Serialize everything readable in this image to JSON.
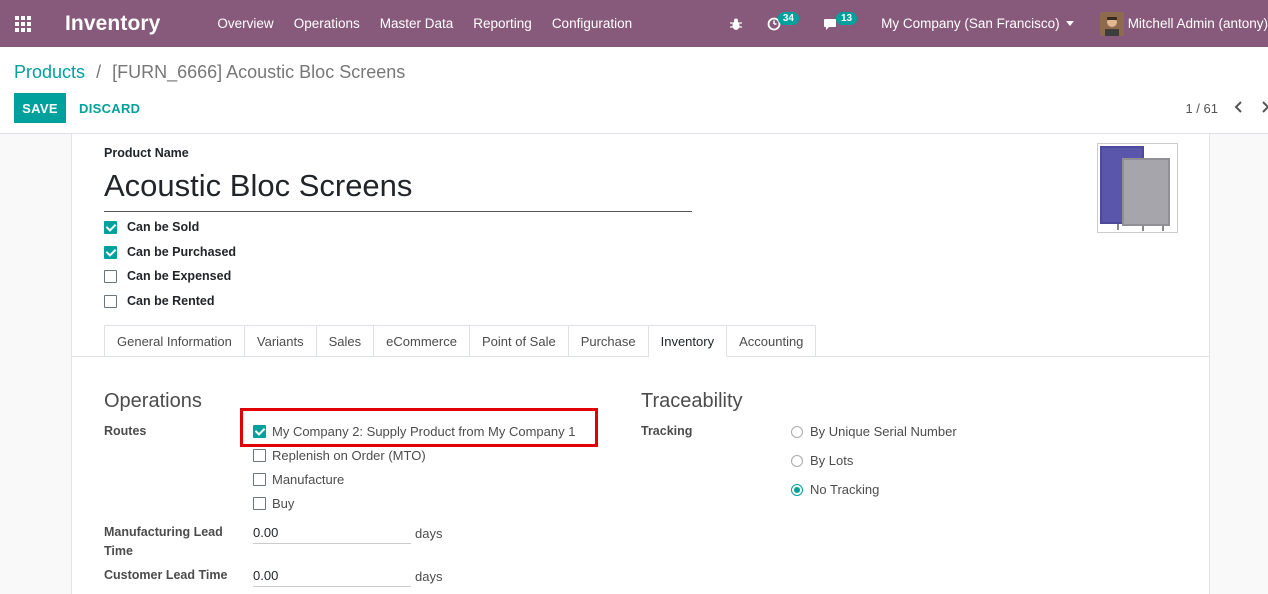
{
  "navbar": {
    "app_title": "Inventory",
    "menu": [
      "Overview",
      "Operations",
      "Master Data",
      "Reporting",
      "Configuration"
    ],
    "activity_count": "34",
    "message_count": "13",
    "company": "My Company (San Francisco)",
    "user": "Mitchell Admin (antony)"
  },
  "control": {
    "breadcrumb_root": "Products",
    "breadcrumb_sep": "/",
    "breadcrumb_current": "[FURN_6666] Acoustic Bloc Screens",
    "save_label": "SAVE",
    "discard_label": "DISCARD",
    "pager": "1 / 61"
  },
  "form": {
    "product_name_label": "Product Name",
    "product_name": "Acoustic Bloc Screens",
    "flags": [
      {
        "label": "Can be Sold",
        "checked": true
      },
      {
        "label": "Can be Purchased",
        "checked": true
      },
      {
        "label": "Can be Expensed",
        "checked": false
      },
      {
        "label": "Can be Rented",
        "checked": false
      }
    ],
    "tabs": [
      "General Information",
      "Variants",
      "Sales",
      "eCommerce",
      "Point of Sale",
      "Purchase",
      "Inventory",
      "Accounting"
    ],
    "active_tab": "Inventory"
  },
  "operations": {
    "title": "Operations",
    "routes_label": "Routes",
    "routes": [
      {
        "label": "My Company 2: Supply Product from My Company 1",
        "checked": true
      },
      {
        "label": "Replenish on Order (MTO)",
        "checked": false
      },
      {
        "label": "Manufacture",
        "checked": false
      },
      {
        "label": "Buy",
        "checked": false
      }
    ],
    "mfg_lead_label_1": "Manufacturing Lead",
    "mfg_lead_label_2": "Time",
    "mfg_lead_value": "0.00",
    "customer_lead_label": "Customer Lead Time",
    "customer_lead_value": "0.00",
    "unit": "days"
  },
  "traceability": {
    "title": "Traceability",
    "tracking_label": "Tracking",
    "options": [
      {
        "label": "By Unique Serial Number",
        "checked": false
      },
      {
        "label": "By Lots",
        "checked": false
      },
      {
        "label": "No Tracking",
        "checked": true
      }
    ]
  },
  "colors": {
    "navbar": "#875a7b",
    "accent": "#00a09d",
    "highlight": "#e30000"
  },
  "icons": [
    "apps-grid-icon",
    "bug-icon",
    "activity-clock-icon",
    "chat-icon",
    "chevron-left-icon",
    "chevron-right-icon"
  ]
}
